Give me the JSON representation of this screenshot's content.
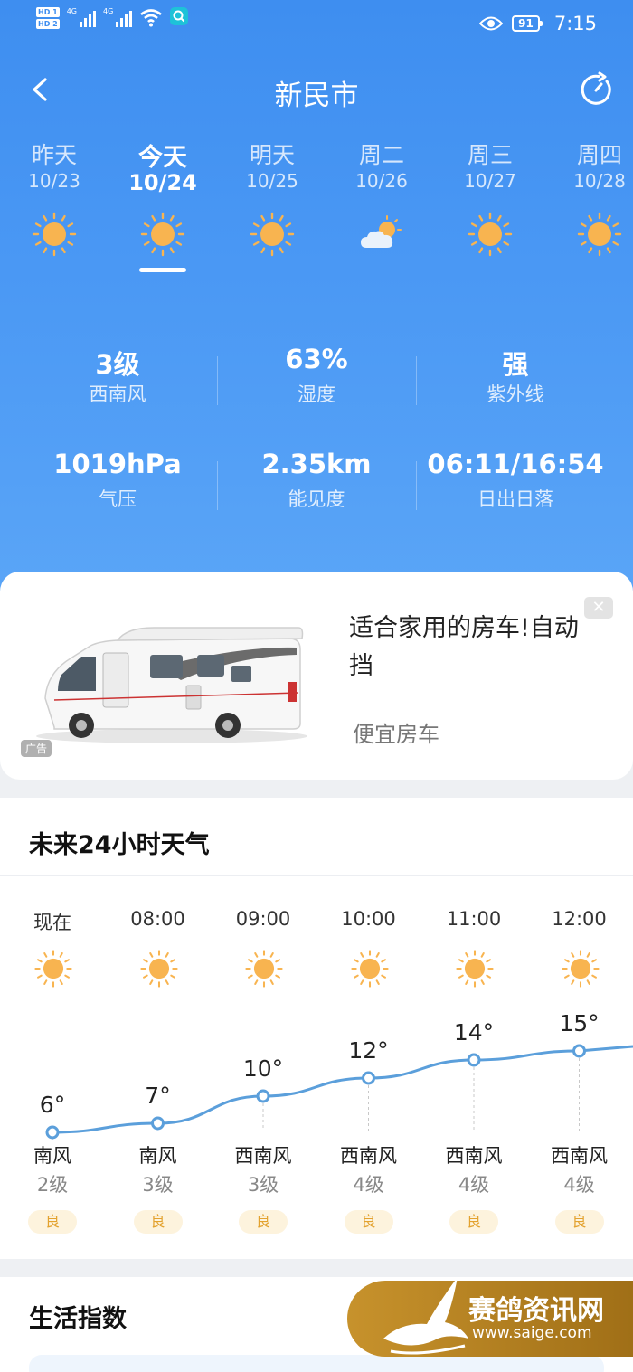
{
  "status_bar": {
    "time": "7:15",
    "battery": "91",
    "hd_badges": [
      "HD 1",
      "HD 2"
    ],
    "network": [
      "4G",
      "4G"
    ],
    "icons": [
      "signal-icon",
      "wifi-icon",
      "search-app-icon",
      "eye-icon",
      "battery-icon"
    ]
  },
  "header": {
    "city": "新民市",
    "back_icon": "chevron-left-icon",
    "refresh_icon": "refresh-icon"
  },
  "days": [
    {
      "name": "昨天",
      "date": "10/23",
      "icon": "sun-icon"
    },
    {
      "name": "今天",
      "date": "10/24",
      "icon": "sun-icon",
      "active": true
    },
    {
      "name": "明天",
      "date": "10/25",
      "icon": "sun-icon"
    },
    {
      "name": "周二",
      "date": "10/26",
      "icon": "partly-cloudy-icon"
    },
    {
      "name": "周三",
      "date": "10/27",
      "icon": "sun-icon"
    },
    {
      "name": "周四",
      "date": "10/28",
      "icon": "sun-icon"
    }
  ],
  "stats": [
    {
      "value": "3级",
      "label": "西南风"
    },
    {
      "value": "63%",
      "label": "湿度"
    },
    {
      "value": "强",
      "label": "紫外线"
    },
    {
      "value": "1019hPa",
      "label": "气压"
    },
    {
      "value": "2.35km",
      "label": "能见度"
    },
    {
      "value": "06:11/16:54",
      "label": "日出日落"
    }
  ],
  "ad": {
    "title": "适合家用的房车!自动挡",
    "source": "便宜房车",
    "tag": "广告",
    "close": "✕"
  },
  "hourly": {
    "title": "未来24小时天气",
    "hours": [
      {
        "time": "现在",
        "temp": 6,
        "temp_label": "6°",
        "wind_dir": "南风",
        "wind_level": "2级",
        "aqi": "良"
      },
      {
        "time": "08:00",
        "temp": 7,
        "temp_label": "7°",
        "wind_dir": "南风",
        "wind_level": "3级",
        "aqi": "良"
      },
      {
        "time": "09:00",
        "temp": 10,
        "temp_label": "10°",
        "wind_dir": "西南风",
        "wind_level": "3级",
        "aqi": "良"
      },
      {
        "time": "10:00",
        "temp": 12,
        "temp_label": "12°",
        "wind_dir": "西南风",
        "wind_level": "4级",
        "aqi": "良"
      },
      {
        "time": "11:00",
        "temp": 14,
        "temp_label": "14°",
        "wind_dir": "西南风",
        "wind_level": "4级",
        "aqi": "良"
      },
      {
        "time": "12:00",
        "temp": 15,
        "temp_label": "15°",
        "wind_dir": "西南风",
        "wind_level": "4级",
        "aqi": "良"
      }
    ]
  },
  "life": {
    "title": "生活指数"
  },
  "watermark": {
    "name": "赛鸽资讯网",
    "url": "www.saige.com"
  },
  "colors": {
    "primary_blue": "#3e8ef0",
    "sun": "#f8b450",
    "curve": "#5b9fdb",
    "aqi_text": "#e3a22f",
    "aqi_bg": "#fdf3dd",
    "watermark_gold": "#b9831f"
  }
}
